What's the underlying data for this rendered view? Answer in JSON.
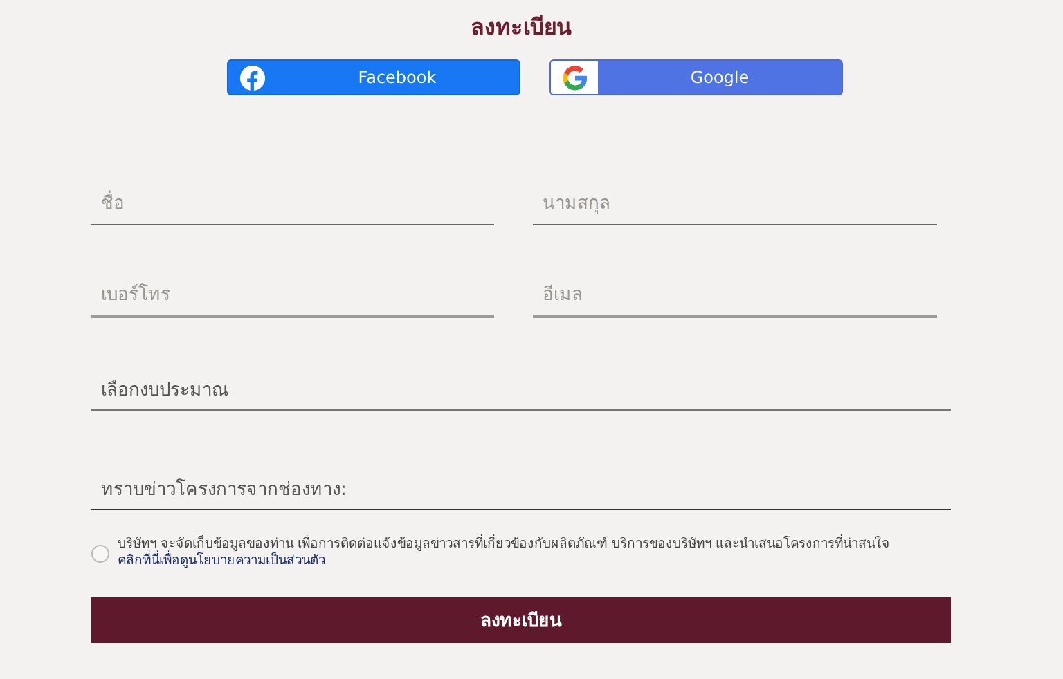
{
  "title": "ลงทะเบียน",
  "social_buttons": [
    {
      "kind": "facebook",
      "label": "Facebook"
    },
    {
      "kind": "google",
      "label": "Google"
    }
  ],
  "fields": [
    {
      "kind": "text",
      "placeholder": "ชื่อ"
    },
    {
      "kind": "text",
      "placeholder": "นามสกุล"
    },
    {
      "kind": "text",
      "placeholder": "เบอร์โทร"
    },
    {
      "kind": "text",
      "placeholder": "อีเมล"
    },
    {
      "kind": "select",
      "label": "เลือกงบประมาณ"
    },
    {
      "kind": "select",
      "label": "ทราบข่าวโครงการจากช่องทาง:"
    }
  ],
  "consent": {
    "checked": false,
    "text": "บริษัทฯ จะจัดเก็บข้อมูลของท่าน เพื่อการติดต่อแจ้งข้อมูลข่าวสารที่เกี่ยวข้องกับผลิตภัณฑ์ บริการของบริษัทฯ และนำเสนอโครงการที่น่าสนใจ",
    "link": "คลิกที่นี่เพื่อดูนโยบายความเป็นส่วนตัว"
  },
  "submit": "ลงทะเบียน"
}
